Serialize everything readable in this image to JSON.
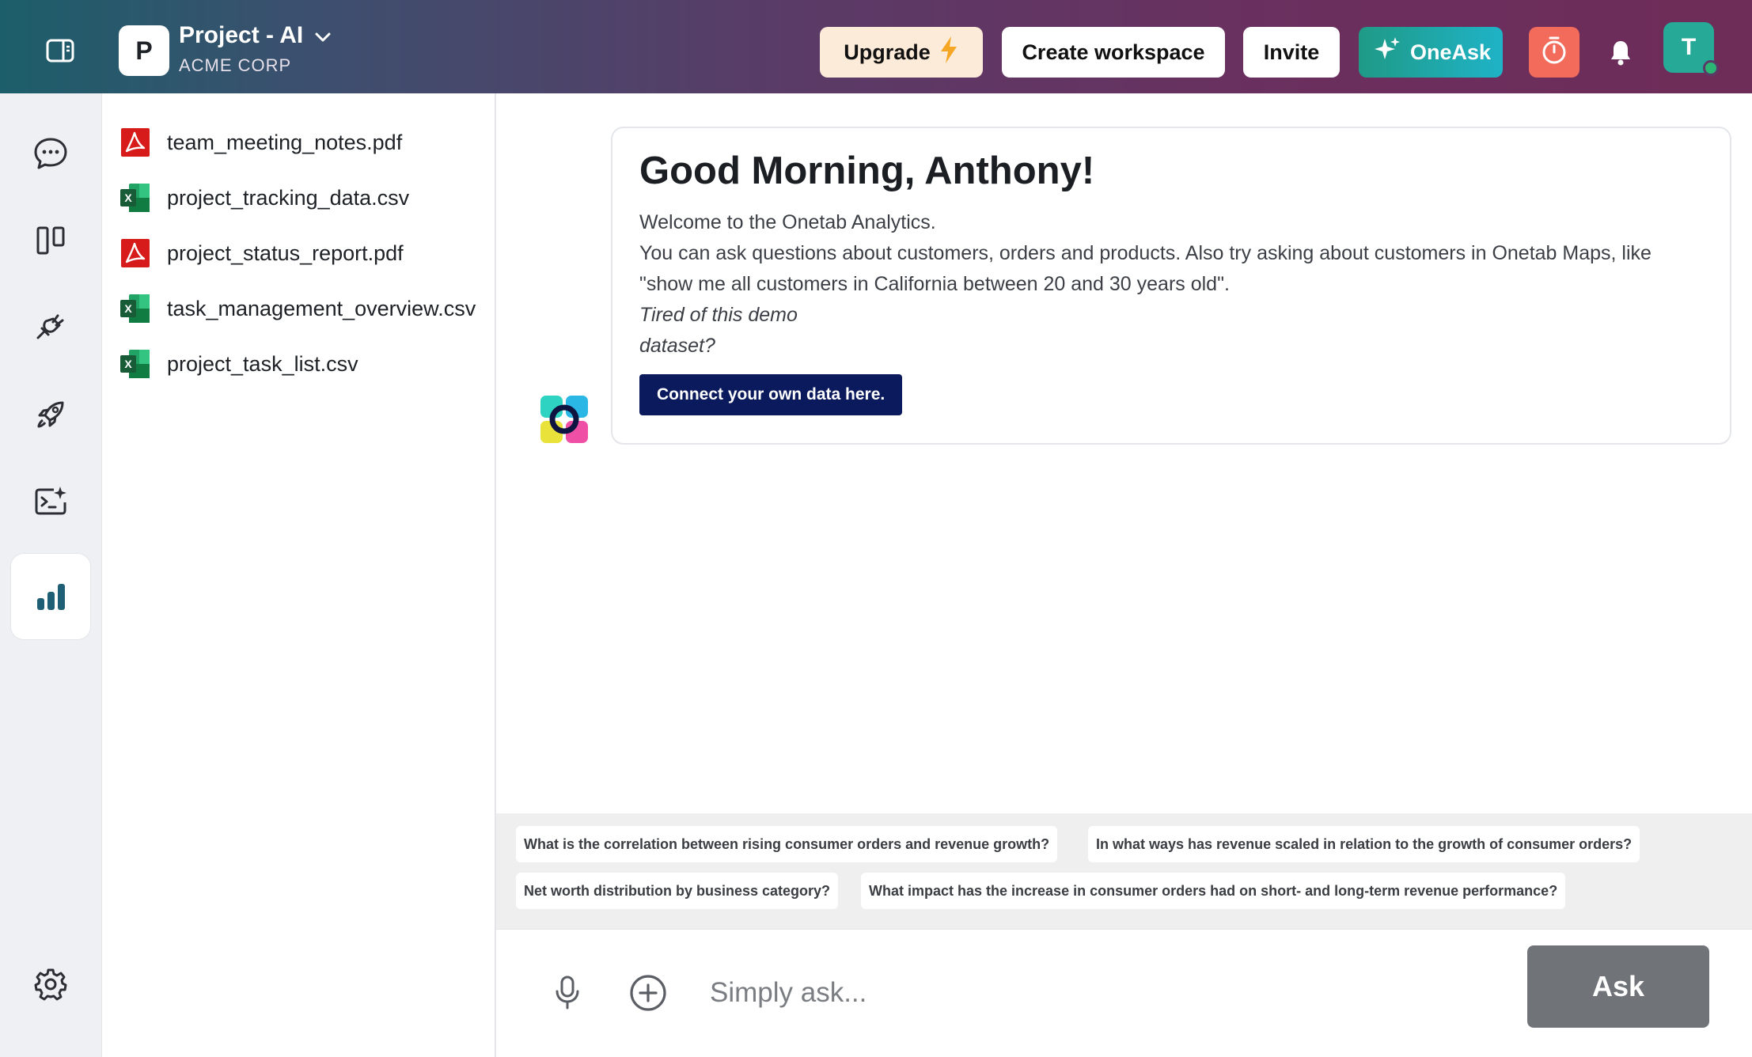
{
  "header": {
    "project_initial": "P",
    "project_name": "Project - AI",
    "org_name": "ACME CORP",
    "upgrade_label": "Upgrade",
    "create_workspace_label": "Create workspace",
    "invite_label": "Invite",
    "oneask_label": "OneAsk",
    "user_initial": "T",
    "colors": {
      "upgrade_bg": "#fdebd9",
      "timer_bg": "#f26b5b",
      "user_bg": "#26a996",
      "oneask_from": "#1f9a86",
      "oneask_to": "#1fb3c7"
    }
  },
  "rail": {
    "items": [
      {
        "icon": "chat-bubble-icon"
      },
      {
        "icon": "columns-icon"
      },
      {
        "icon": "plug-icon"
      },
      {
        "icon": "rocket-icon"
      },
      {
        "icon": "terminal-sparkle-icon"
      },
      {
        "icon": "bar-chart-icon",
        "active": true
      }
    ],
    "bottom_icon": "settings-gear-icon"
  },
  "files": [
    {
      "name": "team_meeting_notes.pdf",
      "type": "pdf"
    },
    {
      "name": "project_tracking_data.csv",
      "type": "csv"
    },
    {
      "name": "project_status_report.pdf",
      "type": "pdf"
    },
    {
      "name": "task_management_overview.csv",
      "type": "csv"
    },
    {
      "name": "project_task_list.csv",
      "type": "csv"
    }
  ],
  "welcome": {
    "greeting": "Good Morning, Anthony!",
    "line1": "Welcome to the Onetab Analytics.",
    "line2": "You can ask questions about customers, orders and products. Also try asking about customers in Onetab Maps, like \"show me all customers in California between 20 and 30 years old\".",
    "tired_line1": "Tired of this demo",
    "tired_line2": "dataset?",
    "connect_label": "Connect your own data here."
  },
  "suggestions": [
    "What is the correlation between rising consumer orders and revenue growth?",
    "In what ways has revenue scaled in relation to the growth of consumer orders?",
    "Net worth distribution by business category?",
    "What impact has the increase in consumer orders had on short- and long-term revenue performance?"
  ],
  "input": {
    "placeholder": "Simply ask...",
    "ask_label": "Ask"
  }
}
